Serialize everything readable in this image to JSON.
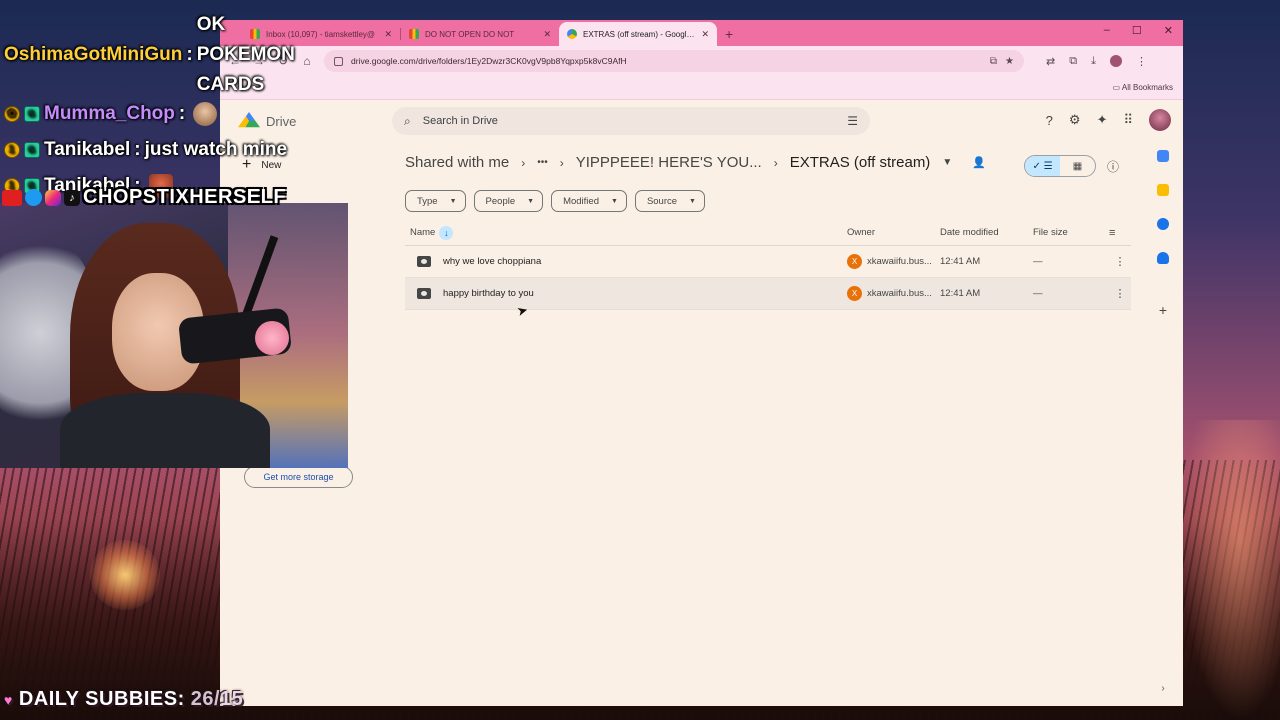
{
  "chat": {
    "messages": [
      {
        "user": "OshimaGotMiniGun",
        "sep": " : ",
        "text": "OK POKEMON CARDS"
      },
      {
        "user": "Mumma_Chop",
        "sep": " :",
        "text": ""
      },
      {
        "user": "Tanikabel",
        "sep": " : ",
        "text": "just watch mine"
      },
      {
        "user": "Tanikabel",
        "sep": " :",
        "text": ""
      }
    ],
    "handle": "CHOPSTIXHERSELF"
  },
  "overlay": {
    "daily_subbies_label": "DAILY SUBBIES:",
    "daily_subbies_value": "26/15"
  },
  "browser": {
    "tabs": [
      {
        "title": "Inbox (10,097) - tiamskettley@",
        "favicon": "gmail-icon",
        "active": false
      },
      {
        "title": "DO NOT OPEN DO NOT",
        "favicon": "gmail-icon",
        "active": false
      },
      {
        "title": "EXTRAS (off stream) - Google D",
        "favicon": "google-drive-icon",
        "active": true
      }
    ],
    "new_tab_label": "+",
    "window_controls": {
      "minimize": "–",
      "maximize": "☐",
      "close": "✕"
    },
    "url": "drive.google.com/drive/folders/1Ey2Dwzr3CK0vgV9pb8Yqpxp5k8vC9AfH",
    "all_bookmarks_label": "All Bookmarks",
    "accent_color": "#ef6fa3"
  },
  "drive": {
    "product_name": "Drive",
    "search_placeholder": "Search in Drive",
    "new_button_label": "New",
    "get_more_storage_label": "Get more storage",
    "breadcrumb": {
      "root": "Shared with me",
      "ellipsis": "•••",
      "middle": "YIPPPEEE! HERE'S YOU...",
      "current": "EXTRAS (off stream)"
    },
    "filters": [
      "Type",
      "People",
      "Modified",
      "Source"
    ],
    "columns": {
      "name": "Name",
      "owner": "Owner",
      "date_modified": "Date modified",
      "file_size": "File size"
    },
    "files": [
      {
        "name": "why we love choppiana",
        "owner_initial": "X",
        "owner": "xkawaiifu.bus...",
        "modified": "12:41 AM",
        "size": "—"
      },
      {
        "name": "happy birthday to you",
        "owner_initial": "X",
        "owner": "xkawaiifu.bus...",
        "modified": "12:41 AM",
        "size": "—"
      }
    ]
  }
}
